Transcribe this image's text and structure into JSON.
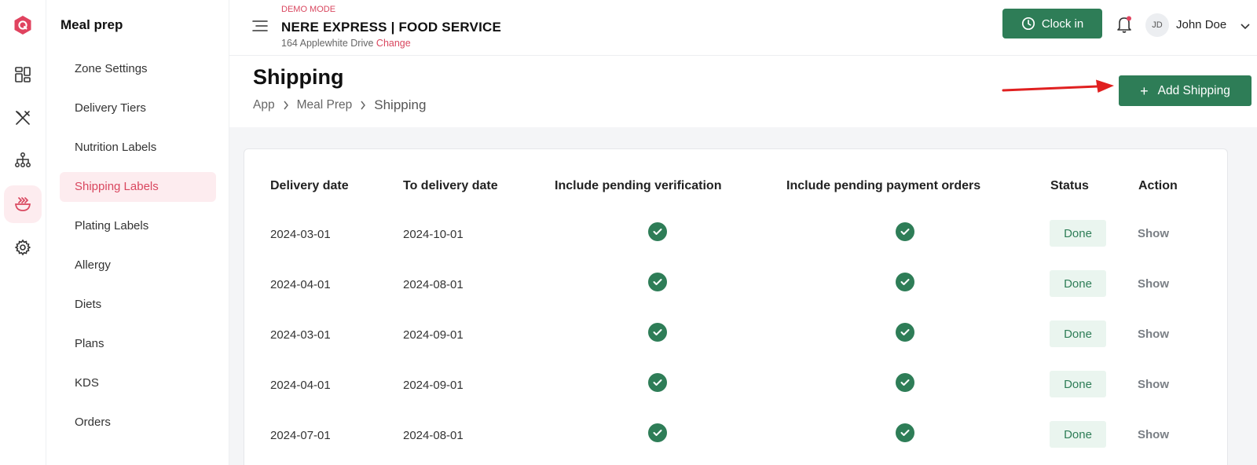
{
  "rail": {
    "items": [
      {
        "icon": "logo-icon"
      },
      {
        "icon": "dashboard-icon"
      },
      {
        "icon": "utensils-icon"
      },
      {
        "icon": "hierarchy-icon"
      },
      {
        "icon": "meal-bowl-icon"
      },
      {
        "icon": "gear-icon"
      }
    ]
  },
  "sidebar": {
    "title": "Meal prep",
    "items": [
      {
        "label": "Zone Settings"
      },
      {
        "label": "Delivery Tiers"
      },
      {
        "label": "Nutrition Labels"
      },
      {
        "label": "Shipping Labels"
      },
      {
        "label": "Plating Labels"
      },
      {
        "label": "Allergy"
      },
      {
        "label": "Diets"
      },
      {
        "label": "Plans"
      },
      {
        "label": "KDS"
      },
      {
        "label": "Orders"
      }
    ],
    "active_index": 3
  },
  "topbar": {
    "mode": "DEMO MODE",
    "org_name": "NERE EXPRESS | FOOD SERVICE",
    "address": "164 Applewhite Drive",
    "change_label": "Change",
    "clock_in_label": "Clock in",
    "user_initials": "JD",
    "user_name": "John Doe"
  },
  "page": {
    "title": "Shipping",
    "breadcrumb": [
      "App",
      "Meal Prep",
      "Shipping"
    ],
    "add_button_label": "Add Shipping"
  },
  "table": {
    "headers": [
      "Delivery date",
      "To delivery date",
      "Include pending verification",
      "Include pending payment orders",
      "Status",
      "Action"
    ],
    "rows": [
      {
        "delivery_date": "2024-03-01",
        "to_delivery_date": "2024-10-01",
        "pending_verification": true,
        "pending_payment": true,
        "status": "Done",
        "action": "Show"
      },
      {
        "delivery_date": "2024-04-01",
        "to_delivery_date": "2024-08-01",
        "pending_verification": true,
        "pending_payment": true,
        "status": "Done",
        "action": "Show"
      },
      {
        "delivery_date": "2024-03-01",
        "to_delivery_date": "2024-09-01",
        "pending_verification": true,
        "pending_payment": true,
        "status": "Done",
        "action": "Show"
      },
      {
        "delivery_date": "2024-04-01",
        "to_delivery_date": "2024-09-01",
        "pending_verification": true,
        "pending_payment": true,
        "status": "Done",
        "action": "Show"
      },
      {
        "delivery_date": "2024-07-01",
        "to_delivery_date": "2024-08-01",
        "pending_verification": true,
        "pending_payment": true,
        "status": "Done",
        "action": "Show"
      }
    ]
  },
  "colors": {
    "primary_green": "#2e7d57",
    "accent_red": "#d9475f",
    "active_bg": "#fdecef",
    "annotation_arrow": "#e02020"
  }
}
